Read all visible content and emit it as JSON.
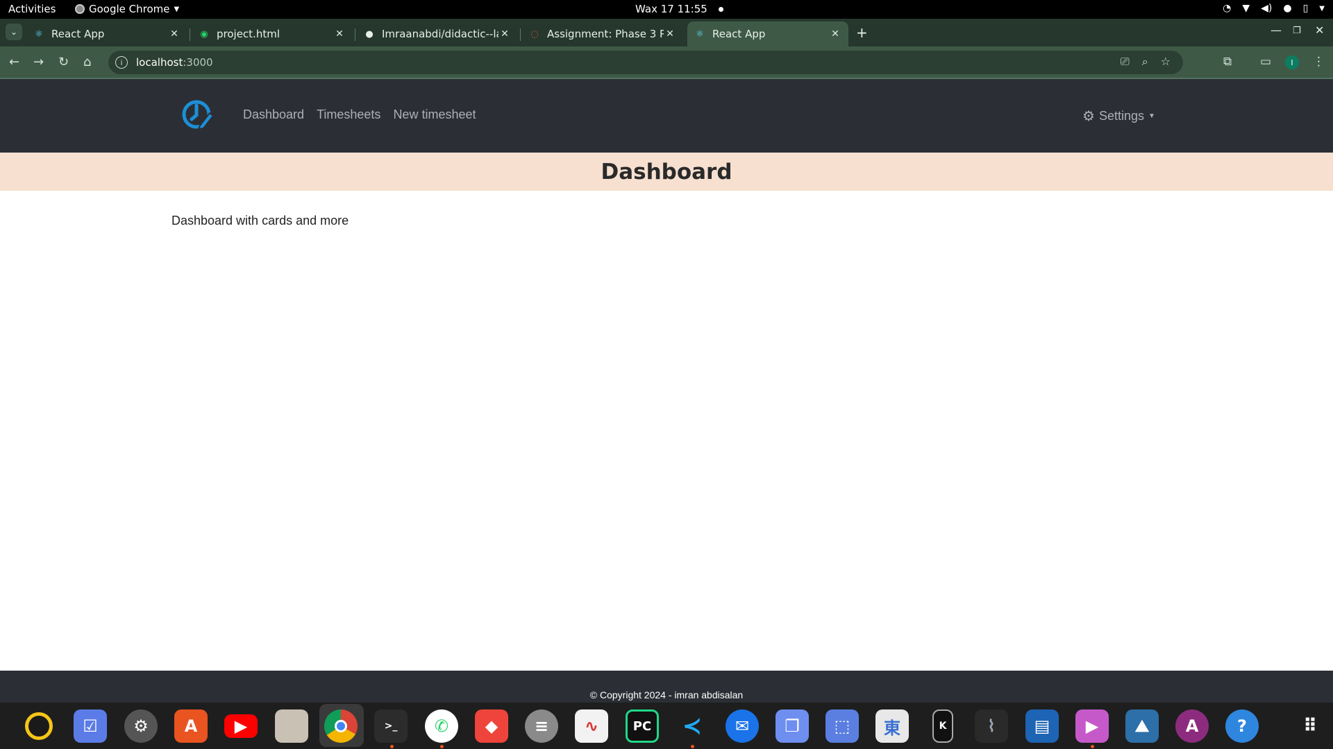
{
  "system_bar": {
    "activities": "Activities",
    "app_name": "Google Chrome",
    "datetime": "Wax 17  11:55"
  },
  "browser": {
    "tabs": [
      {
        "label": "React App",
        "favicon": "react-icon",
        "active": false
      },
      {
        "label": "project.html",
        "favicon": "whatsapp-icon",
        "active": false
      },
      {
        "label": "Imraanabdi/didactic--lam",
        "favicon": "github-icon",
        "active": false
      },
      {
        "label": "Assignment: Phase 3 Pro",
        "favicon": "assignment-icon",
        "active": false
      },
      {
        "label": "React App",
        "favicon": "react-icon",
        "active": true
      }
    ],
    "url_host": "localhost",
    "url_port": ":3000",
    "profile_initial": "I"
  },
  "app": {
    "nav": {
      "links": [
        "Dashboard",
        "Timesheets",
        "New timesheet"
      ],
      "settings_label": "Settings"
    },
    "page_title": "Dashboard",
    "content_text": "Dashboard with cards and more",
    "footer_text": "© Copyright 2024 - imran abdisalan"
  },
  "dock": {
    "apps": [
      "rhythmbox",
      "tasks",
      "settings",
      "app-center",
      "youtube",
      "files",
      "chrome",
      "terminal",
      "whatsapp",
      "anydesk",
      "database",
      "system-monitor-graph",
      "pycharm",
      "vscode",
      "thunderbird",
      "remote-desktop",
      "screenshot",
      "dictionary",
      "kindle",
      "system-monitor",
      "writer",
      "video-player",
      "image-viewer",
      "arduino",
      "help",
      "show-apps"
    ]
  },
  "colors": {
    "nav_bg": "#2b2f35",
    "header_bg": "#f7e0d0",
    "accent_logo": "#1d8fd6",
    "chrome_frame": "#26382e"
  }
}
